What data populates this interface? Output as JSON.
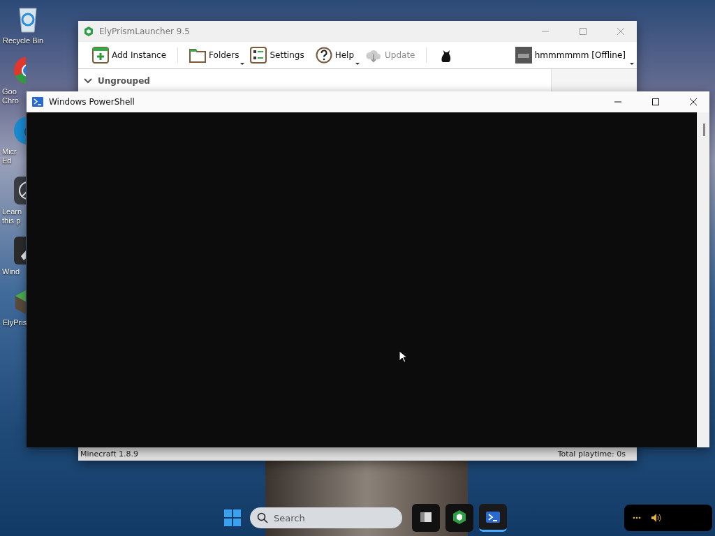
{
  "desktop_icons": [
    {
      "kind": "recycle",
      "lines": [
        "Recycle Bin"
      ]
    },
    {
      "kind": "chrome",
      "lines": [
        "Goo",
        "Chro"
      ]
    },
    {
      "kind": "edge",
      "lines": [
        "Micr",
        "Ed"
      ]
    },
    {
      "kind": "learn",
      "lines": [
        "Learn",
        "this p"
      ]
    },
    {
      "kind": "wind",
      "lines": [
        "Wind"
      ]
    },
    {
      "kind": "ely",
      "lines": [
        "ElyPris"
      ]
    }
  ],
  "launcher": {
    "title": "ElyPrismLauncher 9.5",
    "toolbar": [
      {
        "kind": "add",
        "label": "Add Instance",
        "disabled": false,
        "dropdown": false
      },
      {
        "kind": "folders",
        "label": "Folders",
        "disabled": false,
        "dropdown": true
      },
      {
        "kind": "settings",
        "label": "Settings",
        "disabled": false,
        "dropdown": false
      },
      {
        "kind": "help",
        "label": "Help",
        "disabled": false,
        "dropdown": true
      },
      {
        "kind": "update",
        "label": "Update",
        "disabled": true,
        "dropdown": false
      },
      {
        "kind": "cat",
        "disabled": false,
        "dropdown": false
      }
    ],
    "account": {
      "name": "hmmmmmm [Offline]"
    },
    "group": {
      "label": "Ungrouped",
      "expanded": true
    },
    "status_bar": {
      "left": "Minecraft 1.8.9",
      "right": "Total playtime: 0s"
    }
  },
  "powershell": {
    "title": "Windows PowerShell"
  },
  "taskbar": {
    "search": {
      "placeholder": "Search"
    },
    "apps": [
      {
        "kind": "files",
        "active": false
      },
      {
        "kind": "ely",
        "active": false
      },
      {
        "kind": "shell",
        "active": true
      }
    ]
  }
}
